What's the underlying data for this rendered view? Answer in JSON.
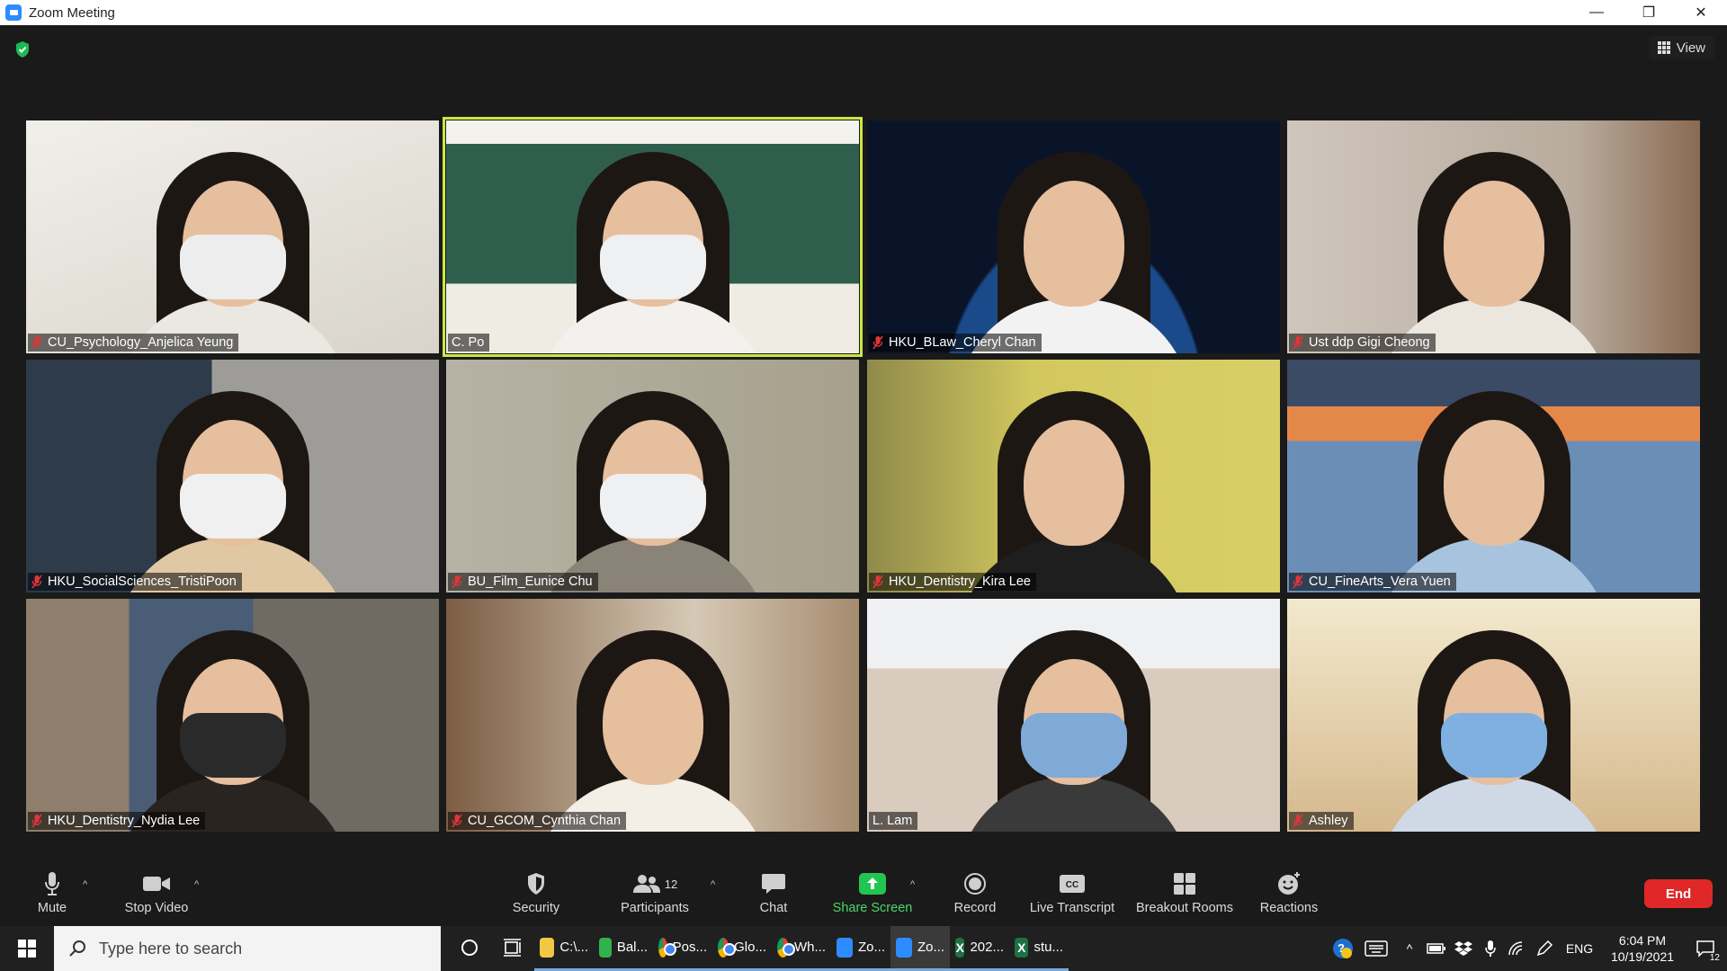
{
  "window": {
    "title": "Zoom Meeting",
    "minimize": "—",
    "restore": "❐",
    "close": "✕"
  },
  "meeting": {
    "view_label": "View",
    "participants": [
      {
        "name": "CU_Psychology_Anjelica Yeung",
        "muted": true
      },
      {
        "name": "C. Po",
        "muted": false,
        "active_speaker": true
      },
      {
        "name": "HKU_BLaw_Cheryl Chan",
        "muted": true
      },
      {
        "name": "Ust ddp Gigi Cheong",
        "muted": true
      },
      {
        "name": "HKU_SocialSciences_TristiPoon",
        "muted": true
      },
      {
        "name": "BU_Film_Eunice Chu",
        "muted": true
      },
      {
        "name": "HKU_Dentistry_Kira Lee",
        "muted": true
      },
      {
        "name": "CU_FineArts_Vera Yuen",
        "muted": true
      },
      {
        "name": "HKU_Dentistry_Nydia Lee",
        "muted": true
      },
      {
        "name": "CU_GCOM_Cynthia Chan",
        "muted": true
      },
      {
        "name": "L. Lam",
        "muted": false
      },
      {
        "name": "Ashley",
        "muted": true
      }
    ]
  },
  "toolbar": {
    "mute_label": "Mute",
    "stop_video_label": "Stop Video",
    "security_label": "Security",
    "participants_label": "Participants",
    "participants_count": "12",
    "chat_label": "Chat",
    "share_screen_label": "Share Screen",
    "record_label": "Record",
    "live_transcript_label": "Live Transcript",
    "breakout_rooms_label": "Breakout Rooms",
    "reactions_label": "Reactions",
    "end_label": "End",
    "cc_label": "CC"
  },
  "taskbar": {
    "search_placeholder": "Type here to search",
    "apps": [
      {
        "label": "C:\\...",
        "icon": "folder-icon",
        "color": "#f2c744"
      },
      {
        "label": "Bal...",
        "icon": "app-icon",
        "color": "#2fb34b"
      },
      {
        "label": "Pos...",
        "icon": "chrome-icon"
      },
      {
        "label": "Glo...",
        "icon": "chrome-icon"
      },
      {
        "label": "Wh...",
        "icon": "chrome-icon"
      },
      {
        "label": "Zo...",
        "icon": "zoom-icon",
        "color": "#2D8CFF"
      },
      {
        "label": "Zo...",
        "icon": "zoom-icon",
        "color": "#2D8CFF"
      },
      {
        "label": "202...",
        "icon": "excel-icon",
        "color": "#1d7144"
      },
      {
        "label": "stu...",
        "icon": "excel-icon",
        "color": "#1d7144"
      }
    ],
    "language": "ENG",
    "time": "6:04 PM",
    "date": "10/19/2021",
    "notification_count": "12"
  },
  "colors": {
    "accent": "#2D8CFF",
    "end_red": "#e02828",
    "share_green": "#4ad86a",
    "active_speaker": "#c8e840"
  }
}
